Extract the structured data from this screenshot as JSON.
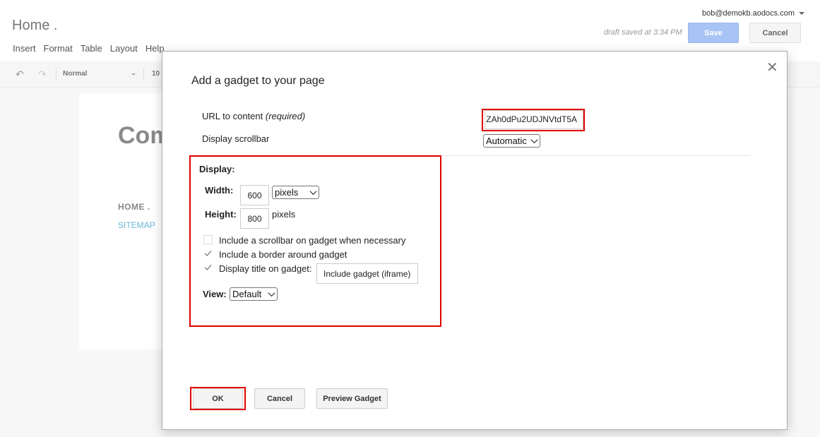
{
  "header": {
    "user_email": "bob@demokb.aodocs.com",
    "page_title": "Home .",
    "draft_status": "draft saved at 3:34 PM",
    "save_label": "Save",
    "cancel_label": "Cancel"
  },
  "menubar": {
    "items": [
      {
        "label": "Insert"
      },
      {
        "label": "Format"
      },
      {
        "label": "Table"
      },
      {
        "label": "Layout"
      },
      {
        "label": "Help"
      }
    ]
  },
  "toolbar": {
    "undo_icon": "undo-icon",
    "redo_icon": "redo-icon",
    "style_value": "Normal",
    "font_size_value": "10"
  },
  "canvas": {
    "site_heading": "Com",
    "nav_home": "HOME .",
    "nav_sitemap": "SITEMAP"
  },
  "dialog": {
    "title": "Add a gadget to your page",
    "close_icon": "close-icon",
    "url_label": "URL to content",
    "url_required": "(required)",
    "url_value": "ZAh0dPu2UDJNVtdT5A",
    "scrollbar_label": "Display scrollbar",
    "scrollbar_value": "Automatic",
    "display_heading": "Display:",
    "width_label": "Width:",
    "width_value": "600",
    "width_unit": "pixels",
    "height_label": "Height:",
    "height_value": "800",
    "height_unit": "pixels",
    "checkboxes": [
      {
        "label": "Include a scrollbar on gadget when necessary",
        "checked": false
      },
      {
        "label": "Include a border around gadget",
        "checked": true
      },
      {
        "label": "Display title on gadget:",
        "checked": true
      }
    ],
    "gadget_title_value": "Include gadget (iframe)",
    "view_label": "View:",
    "view_value": "Default",
    "ok_label": "OK",
    "cancel_label": "Cancel",
    "preview_label": "Preview Gadget"
  },
  "colors": {
    "highlight": "#e00000",
    "save_button": "#a8c4f4",
    "sitemap_link": "#6ab7d6"
  }
}
